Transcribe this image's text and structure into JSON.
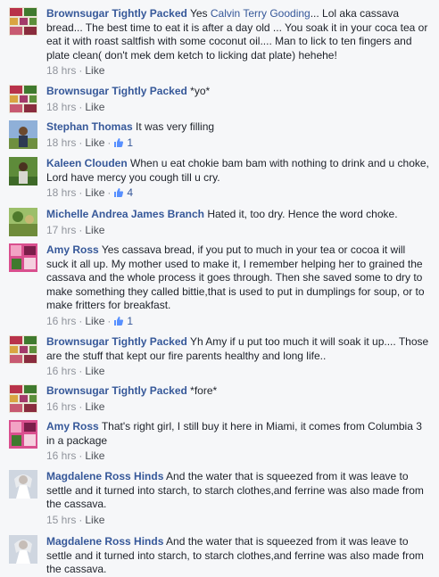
{
  "comments": [
    {
      "author": "Brownsugar Tightly Packed",
      "mention": "Calvin Terry Gooding",
      "text_before": "Yes ",
      "text": "... Lol aka cassava bread... The best time to eat it is after a day old ... You soak it in your coca tea or eat it with roast saltfish with some coconut oil.... Man to lick to ten fingers and plate clean( don't mek dem ketch to licking dat plate) hehehe!",
      "time": "18 hrs",
      "like": "Like",
      "likes": "",
      "avatar": "flower-collage-avatar"
    },
    {
      "author": "Brownsugar Tightly Packed",
      "text": "*yo*",
      "time": "18 hrs",
      "like": "Like",
      "likes": "",
      "avatar": "flower-collage-avatar"
    },
    {
      "author": "Stephan Thomas",
      "text": "It was very filling",
      "time": "18 hrs",
      "like": "Like",
      "likes": "1",
      "avatar": "outdoor-person-avatar"
    },
    {
      "author": "Kaleen Clouden",
      "text": "When u eat chokie bam bam with nothing to drink and u choke, Lord have mercy you cough till u cry.",
      "time": "18 hrs",
      "like": "Like",
      "likes": "4",
      "avatar": "garden-person-avatar"
    },
    {
      "author": "Michelle Andrea James Branch",
      "text": "Hated it, too dry. Hence the word choke.",
      "time": "17 hrs",
      "like": "Like",
      "likes": "",
      "avatar": "nature-avatar"
    },
    {
      "author": "Amy Ross",
      "text": "Yes cassava bread, if you put to much in your tea or cocoa it will suck it all up. My mother used to make it, I remember helping her to grained the cassava and the whole process it goes through. Then she saved some to dry to make something they called bittie,that is used to put in dumplings for soup, or to make fritters for breakfast.",
      "time": "16 hrs",
      "like": "Like",
      "likes": "1",
      "avatar": "pink-collage-avatar"
    },
    {
      "author": "Brownsugar Tightly Packed",
      "text": "Yh Amy if u put too much it will soak it up.... Those are the stuff that kept our fire parents healthy and long life..",
      "time": "16 hrs",
      "like": "Like",
      "likes": "",
      "avatar": "flower-collage-avatar"
    },
    {
      "author": "Brownsugar Tightly Packed",
      "text": "*fore*",
      "time": "16 hrs",
      "like": "Like",
      "likes": "",
      "avatar": "flower-collage-avatar"
    },
    {
      "author": "Amy Ross",
      "text": "That's right girl, I still buy it here in Miami, it comes from Columbia 3 in a package",
      "time": "16 hrs",
      "like": "Like",
      "likes": "",
      "avatar": "pink-collage-avatar"
    },
    {
      "author": "Magdalene Ross Hinds",
      "text": "And the water that is squeezed from it was leave to settle and it turned into starch, to starch clothes,and ferrine was also made from the cassava.",
      "time": "15 hrs",
      "like": "Like",
      "likes": "",
      "avatar": "bride-avatar"
    },
    {
      "author": "Magdalene Ross Hinds",
      "text": "And the water that is squeezed from it was leave to settle and it turned into starch, to starch clothes,and ferrine was also made from the cassava.",
      "time": "",
      "like": "",
      "likes": "",
      "avatar": "bride-avatar"
    }
  ],
  "colors": {
    "link": "#365899",
    "meta": "#90949c",
    "background": "#f6f7f9"
  }
}
